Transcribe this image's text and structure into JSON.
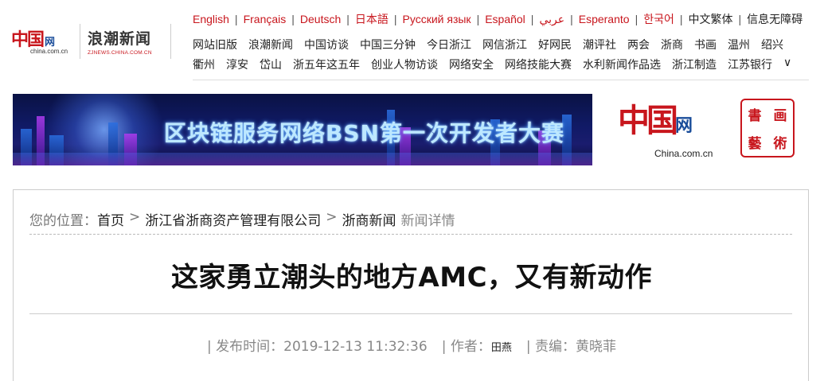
{
  "logos": {
    "china_mark": "中国网",
    "china_mark_main": "中国",
    "china_mark_suffix": "网",
    "china_url": "china.com.cn",
    "zj_mark": "浪潮新闻",
    "zj_url": "ZJNEWS.CHINA.COM.CN"
  },
  "languages": [
    {
      "label": "English"
    },
    {
      "label": "Français"
    },
    {
      "label": "Deutsch"
    },
    {
      "label": "日本語"
    },
    {
      "label": "Русский язык"
    },
    {
      "label": "Español"
    },
    {
      "label": "عربي"
    },
    {
      "label": "Esperanto"
    },
    {
      "label": "한국어"
    },
    {
      "label": "中文繁体"
    },
    {
      "label": "信息无障碍"
    }
  ],
  "nav_row1": [
    "网站旧版",
    "浪潮新闻",
    "中国访谈",
    "中国三分钟",
    "今日浙江",
    "网信浙江",
    "好网民",
    "潮评社",
    "两会",
    "浙商",
    "书画",
    "温州",
    "绍兴"
  ],
  "nav_row2": [
    "衢州",
    "淳安",
    "岱山",
    "浙五年这五年",
    "创业人物访谈",
    "网络安全",
    "网络技能大赛",
    "水利新闻作品选",
    "浙江制造",
    "江苏银行",
    "∨"
  ],
  "banner": {
    "title": "区块链服务网络BSN第一次开发者大赛"
  },
  "ad": {
    "china_mark_main": "中国",
    "china_mark_suffix": "网",
    "china_url": "China.com.cn",
    "seal_chars": [
      "書",
      "画",
      "藝",
      "術"
    ]
  },
  "breadcrumb": {
    "prefix": "您的位置：",
    "items": [
      "首页",
      "浙江省浙商资产管理有限公司",
      "浙商新闻"
    ],
    "separator": ">",
    "current": "新闻详情"
  },
  "article": {
    "title": "这家勇立潮头的地方AMC，又有新动作",
    "publish_label": "| 发布时间：",
    "publish_time": "2019-12-13 11:32:36",
    "author_label": "| 作者：",
    "author": "田燕",
    "editor_label": "| 责编：",
    "editor": "黄晓菲"
  },
  "colors": {
    "brand_red": "#c8161d",
    "brand_blue": "#1a4d9a"
  }
}
